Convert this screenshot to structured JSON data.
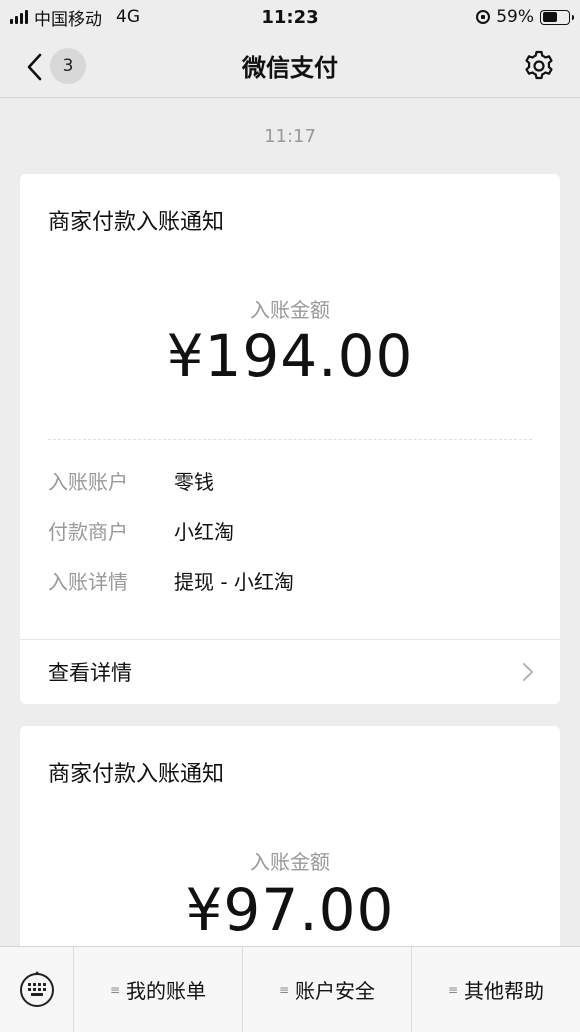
{
  "status_bar": {
    "carrier": "中国移动",
    "network": "4G",
    "time": "11:23",
    "battery": "59%",
    "battery_level": 0.59
  },
  "nav": {
    "back_badge": "3",
    "title": "微信支付"
  },
  "timestamp": "11:17",
  "cards": [
    {
      "title": "商家付款入账通知",
      "amount_label": "入账金额",
      "amount": "¥194.00",
      "details": [
        {
          "label": "入账账户",
          "value": "零钱"
        },
        {
          "label": "付款商户",
          "value": "小红淘"
        },
        {
          "label": "入账详情",
          "value": "提现 - 小红淘"
        }
      ],
      "view_details": "查看详情"
    },
    {
      "title": "商家付款入账通知",
      "amount_label": "入账金额",
      "amount": "¥97.00"
    }
  ],
  "bottom_menu": {
    "items": [
      "我的账单",
      "账户安全",
      "其他帮助"
    ]
  },
  "colors": {
    "background": "#ededed",
    "card": "#ffffff",
    "muted_text": "#999999"
  }
}
